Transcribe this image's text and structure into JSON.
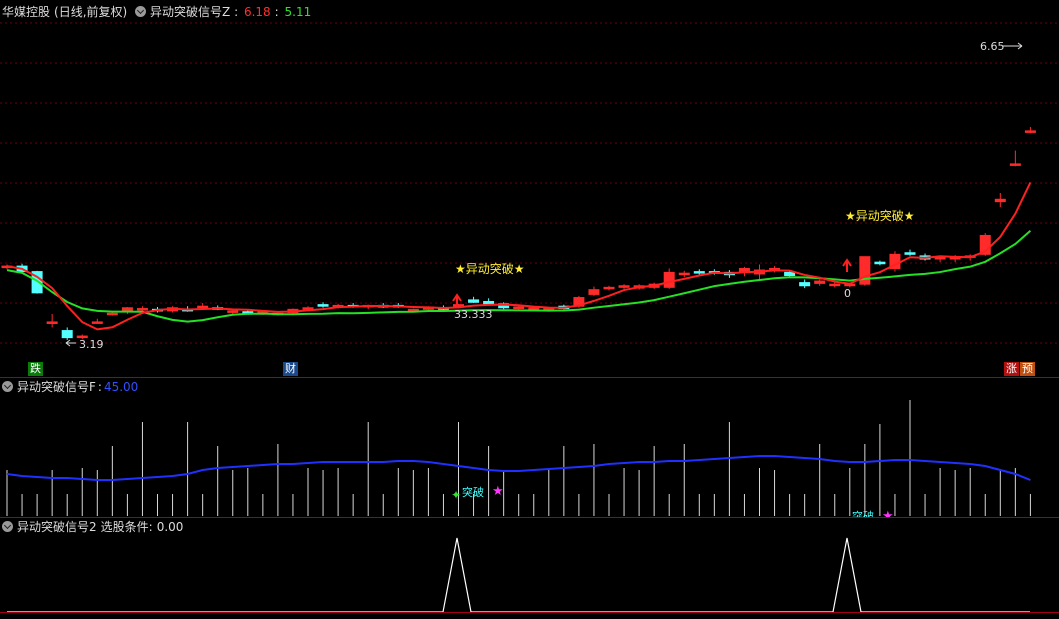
{
  "main_header": {
    "stock": "华媒控股",
    "mode": "(日线,前复权)",
    "indicator": "异动突破信号Z",
    "value_red": "6.18",
    "value_green": "5.11",
    "colors": {
      "label": "#dddddd",
      "red": "#ff3030",
      "green": "#30e030"
    }
  },
  "main_chart": {
    "high_label": "6.65",
    "low_label": "3.19",
    "signal_text": "★异动突破★",
    "signal_value_1": "33.333",
    "signal_value_2": "0",
    "tag_left": "跌",
    "tag_mid": "财",
    "tag_right_1": "涨",
    "tag_right_2": "预"
  },
  "sub1_header": {
    "indicator": "异动突破信号F",
    "value": "45.00"
  },
  "sub1_chart": {
    "signal_text": "突破"
  },
  "sub2_header": {
    "indicator": "异动突破信号2",
    "condition_label": "选股条件:",
    "condition_value": "0.00"
  },
  "chart_data": [
    {
      "type": "candlestick",
      "title": "异动突破信号Z",
      "ylim": [
        3.19,
        6.65
      ],
      "candles": [
        [
          4.12,
          4.15,
          4.09,
          4.13
        ],
        [
          4.13,
          4.16,
          4.05,
          4.06
        ],
        [
          4.06,
          4.07,
          3.78,
          3.79
        ],
        [
          3.4,
          3.52,
          3.35,
          3.42
        ],
        [
          3.31,
          3.35,
          3.19,
          3.22
        ],
        [
          3.24,
          3.26,
          3.2,
          3.24
        ],
        [
          3.42,
          3.46,
          3.4,
          3.42
        ],
        [
          3.52,
          3.56,
          3.5,
          3.53
        ],
        [
          3.55,
          3.61,
          3.52,
          3.6
        ],
        [
          3.58,
          3.62,
          3.54,
          3.59
        ],
        [
          3.58,
          3.61,
          3.54,
          3.56
        ],
        [
          3.56,
          3.62,
          3.54,
          3.6
        ],
        [
          3.58,
          3.62,
          3.55,
          3.56
        ],
        [
          3.62,
          3.66,
          3.6,
          3.62
        ],
        [
          3.6,
          3.63,
          3.57,
          3.58
        ],
        [
          3.55,
          3.58,
          3.52,
          3.56
        ],
        [
          3.55,
          3.58,
          3.52,
          3.54
        ],
        [
          3.55,
          3.57,
          3.51,
          3.56
        ],
        [
          3.52,
          3.55,
          3.5,
          3.53
        ],
        [
          3.54,
          3.59,
          3.52,
          3.58
        ],
        [
          3.58,
          3.62,
          3.56,
          3.6
        ],
        [
          3.64,
          3.67,
          3.6,
          3.62
        ],
        [
          3.61,
          3.65,
          3.59,
          3.63
        ],
        [
          3.63,
          3.66,
          3.6,
          3.61
        ],
        [
          3.61,
          3.64,
          3.58,
          3.63
        ],
        [
          3.63,
          3.66,
          3.6,
          3.62
        ],
        [
          3.63,
          3.66,
          3.6,
          3.61
        ],
        [
          3.57,
          3.59,
          3.55,
          3.58
        ],
        [
          3.58,
          3.62,
          3.56,
          3.61
        ],
        [
          3.6,
          3.63,
          3.57,
          3.59
        ],
        [
          3.62,
          3.65,
          3.59,
          3.64
        ],
        [
          3.7,
          3.74,
          3.66,
          3.67
        ],
        [
          3.68,
          3.72,
          3.64,
          3.65
        ],
        [
          3.65,
          3.67,
          3.58,
          3.6
        ],
        [
          3.6,
          3.63,
          3.58,
          3.61
        ],
        [
          3.59,
          3.62,
          3.57,
          3.6
        ],
        [
          3.58,
          3.61,
          3.55,
          3.6
        ],
        [
          3.62,
          3.64,
          3.58,
          3.59
        ],
        [
          3.62,
          3.75,
          3.6,
          3.73
        ],
        [
          3.77,
          3.87,
          3.75,
          3.83
        ],
        [
          3.85,
          3.88,
          3.82,
          3.86
        ],
        [
          3.86,
          3.9,
          3.84,
          3.88
        ],
        [
          3.85,
          3.9,
          3.83,
          3.88
        ],
        [
          3.86,
          3.92,
          3.84,
          3.9
        ],
        [
          3.86,
          4.1,
          3.84,
          4.05
        ],
        [
          4.03,
          4.07,
          3.99,
          4.04
        ],
        [
          4.06,
          4.09,
          4.02,
          4.05
        ],
        [
          4.06,
          4.09,
          4.02,
          4.04
        ],
        [
          4.05,
          4.08,
          3.98,
          4.02
        ],
        [
          4.05,
          4.12,
          4.0,
          4.1
        ],
        [
          4.03,
          4.15,
          3.95,
          4.08
        ],
        [
          4.09,
          4.13,
          4.05,
          4.1
        ],
        [
          4.05,
          4.07,
          3.98,
          4.01
        ],
        [
          3.92,
          3.96,
          3.85,
          3.88
        ],
        [
          3.91,
          3.96,
          3.88,
          3.94
        ],
        [
          3.89,
          3.94,
          3.86,
          3.9
        ],
        [
          3.88,
          3.92,
          3.86,
          3.9
        ],
        [
          3.9,
          4.08,
          3.88,
          4.25
        ],
        [
          4.18,
          4.2,
          4.14,
          4.16
        ],
        [
          4.1,
          4.32,
          4.06,
          4.28
        ],
        [
          4.3,
          4.34,
          4.26,
          4.28
        ],
        [
          4.26,
          4.29,
          4.2,
          4.22
        ],
        [
          4.22,
          4.26,
          4.18,
          4.24
        ],
        [
          4.22,
          4.27,
          4.18,
          4.25
        ],
        [
          4.25,
          4.28,
          4.2,
          4.26
        ],
        [
          4.28,
          4.55,
          4.26,
          4.52
        ],
        [
          4.95,
          5.06,
          4.88,
          4.98
        ],
        [
          5.42,
          5.6,
          5.4,
          5.43
        ],
        [
          5.84,
          5.9,
          5.82,
          5.85
        ]
      ]
    },
    {
      "type": "bar",
      "title": "异动突破信号F",
      "series": [
        {
          "name": "异动突破信号F",
          "values": [
            45
          ]
        }
      ]
    },
    {
      "type": "line",
      "title": "异动突破信号2",
      "series": [
        {
          "name": "选股条件",
          "values": [
            0
          ]
        }
      ]
    }
  ]
}
